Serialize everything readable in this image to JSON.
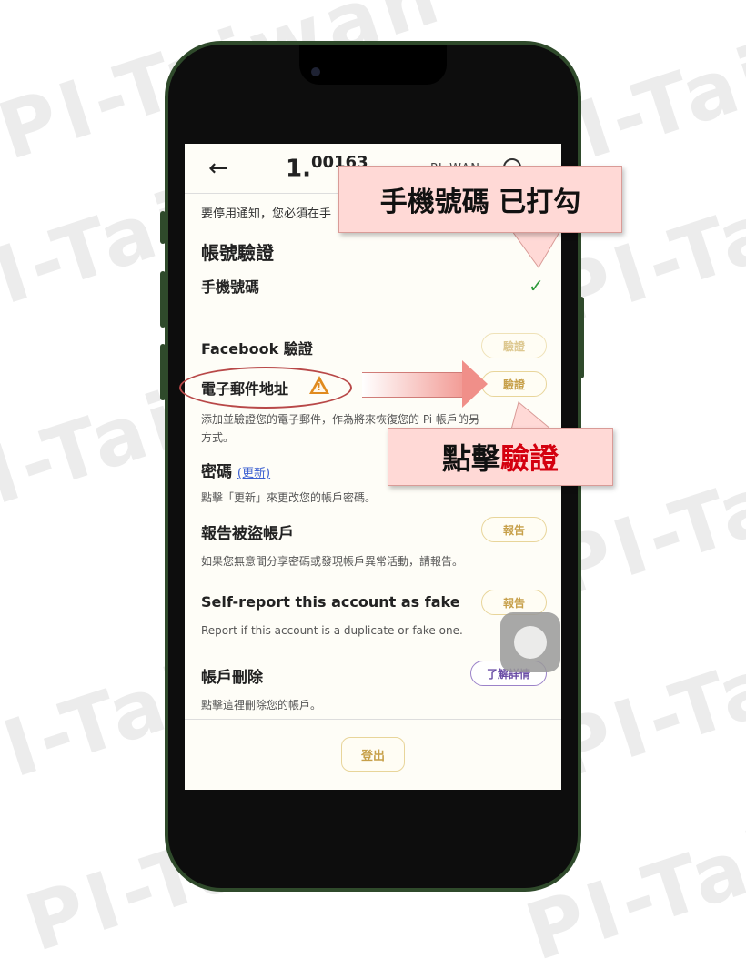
{
  "watermark": "PI-Taiwan",
  "header": {
    "balance_main": "1.",
    "balance_sup": "00163",
    "user_id": "PI_WAN",
    "back": "←"
  },
  "notice_text": "要停用通知，您必須在手",
  "account_verification": {
    "title": "帳號驗證",
    "phone": {
      "label": "手機號碼",
      "status_icon": "✓"
    },
    "facebook": {
      "label": "Facebook 驗證",
      "button": "驗證"
    },
    "email": {
      "label": "電子郵件地址",
      "warn_icon": "!",
      "button": "驗證",
      "description_line1": "添加並驗證您的電子郵件，作為將來恢復您的 Pi 帳戶的另一",
      "description_line2": "方式。"
    }
  },
  "password": {
    "title": "密碼",
    "link": "(更新)",
    "description": "點擊「更新」來更改您的帳戶密碼。"
  },
  "report_stolen": {
    "title": "報告被盜帳戶",
    "button": "報告",
    "description": "如果您無意間分享密碼或發現帳戶異常活動，請報告。"
  },
  "self_report": {
    "title": "Self-report this account as fake",
    "button": "報告",
    "description": "Report if this account is a duplicate or fake one."
  },
  "delete_account": {
    "title": "帳戶刪除",
    "button": "了解詳情",
    "description": "點擊這裡刪除您的帳戶。"
  },
  "footer": {
    "logout": "登出"
  },
  "annotations": {
    "top_callout": "手機號碼  已打勾",
    "bottom_callout_prefix": "點擊",
    "bottom_callout_highlight": "驗證"
  },
  "colors": {
    "accent_gold": "#c7a04a",
    "check_green": "#2e9a3c",
    "warning_orange": "#e08a1e",
    "callout_pink": "#ffd9d6",
    "highlight_red": "#d4000f",
    "phone_frame": "#2f4a2b"
  }
}
